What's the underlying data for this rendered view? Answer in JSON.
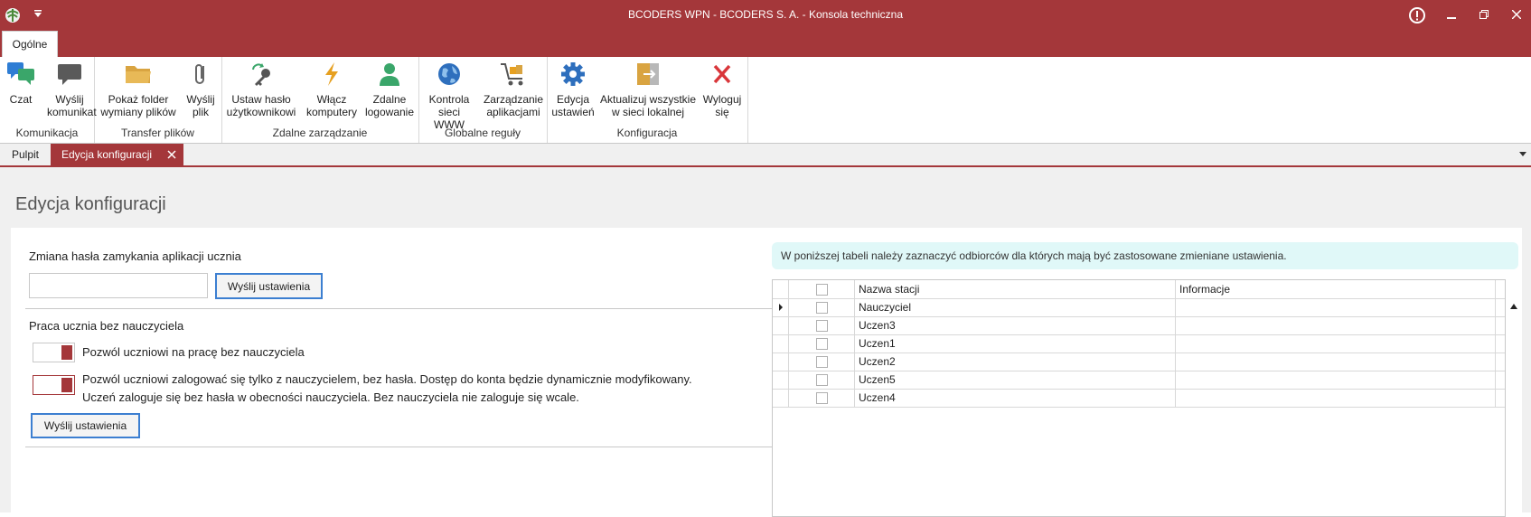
{
  "window": {
    "title": "BCODERS WPN - BCODERS S. A. - Konsola techniczna"
  },
  "ribbon": {
    "tab": "Ogólne",
    "groups": [
      {
        "label": "Komunikacja",
        "buttons": [
          {
            "label_1": "Czat",
            "label_2": ""
          },
          {
            "label_1": "Wyślij",
            "label_2": "komunikat"
          }
        ]
      },
      {
        "label": "Transfer plików",
        "buttons": [
          {
            "label_1": "Pokaż folder",
            "label_2": "wymiany plików"
          },
          {
            "label_1": "Wyślij",
            "label_2": "plik"
          }
        ]
      },
      {
        "label": "Zdalne zarządzanie",
        "buttons": [
          {
            "label_1": "Ustaw hasło",
            "label_2": "użytkownikowi"
          },
          {
            "label_1": "Włącz",
            "label_2": "komputery"
          },
          {
            "label_1": "Zdalne",
            "label_2": "logowanie"
          }
        ]
      },
      {
        "label": "Globalne reguły",
        "buttons": [
          {
            "label_1": "Kontrola",
            "label_2": "sieci WWW"
          },
          {
            "label_1": "Zarządzanie",
            "label_2": "aplikacjami"
          }
        ]
      },
      {
        "label": "Konfiguracja",
        "buttons": [
          {
            "label_1": "Edycja",
            "label_2": "ustawień"
          },
          {
            "label_1": "Aktualizuj wszystkie",
            "label_2": "w sieci lokalnej"
          },
          {
            "label_1": "Wyloguj",
            "label_2": "się"
          }
        ]
      }
    ]
  },
  "doc_tabs": [
    {
      "label": "Pulpit"
    },
    {
      "label": "Edycja konfiguracji"
    }
  ],
  "page": {
    "title": "Edycja konfiguracji",
    "password_section": {
      "title": "Zmiana hasła zamykania aplikacji ucznia",
      "input_value": "",
      "send_label": "Wyślij ustawienia"
    },
    "work_section": {
      "title": "Praca ucznia bez nauczyciela",
      "option1": "Pozwól uczniowi na pracę bez nauczyciela",
      "option2_line1": "Pozwól uczniowi zalogować się tylko z nauczycielem, bez hasła. Dostęp do konta będzie dynamicznie modyfikowany.",
      "option2_line2": "Uczeń zaloguje się bez hasła w obecności nauczyciela. Bez nauczyciela nie zaloguje się wcale.",
      "send_label": "Wyślij ustawienia"
    },
    "info_banner": "W poniższej tabeli należy zaznaczyć odbiorców dla których mają być zastosowane zmieniane ustawienia.",
    "table": {
      "columns": [
        "Nazwa stacji",
        "Informacje"
      ],
      "rows": [
        {
          "name": "Nauczyciel",
          "info": ""
        },
        {
          "name": "Uczen3",
          "info": ""
        },
        {
          "name": "Uczen1",
          "info": ""
        },
        {
          "name": "Uczen2",
          "info": ""
        },
        {
          "name": "Uczen5",
          "info": ""
        },
        {
          "name": "Uczen4",
          "info": ""
        }
      ]
    }
  },
  "colors": {
    "brand": "#a4373a",
    "focus_border": "#3c7fd1",
    "banner": "#e0f8f8"
  }
}
